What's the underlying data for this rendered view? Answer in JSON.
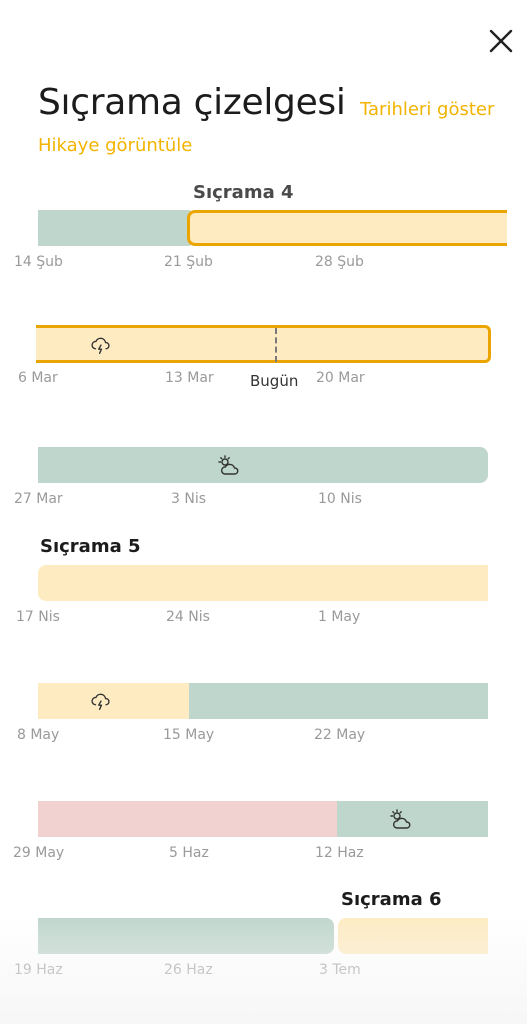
{
  "header": {
    "title": "Sıçrama çizelgesi",
    "show_dates": "Tarihleri göster",
    "view_story": "Hikaye görüntüle",
    "close_icon": "close-icon"
  },
  "leaps": [
    "Sıçrama 4",
    "Sıçrama 5",
    "Sıçrama 6"
  ],
  "weeks": [
    {
      "dates": [
        "14 Şub",
        "21 Şub",
        "28 Şub"
      ]
    },
    {
      "dates": [
        "6 Mar",
        "13 Mar",
        "20 Mar"
      ],
      "today_label": "Bugün",
      "icon": "stormy-cloud-icon"
    },
    {
      "dates": [
        "27 Mar",
        "3 Nis",
        "10 Nis"
      ],
      "icon": "sun-behind-cloud-icon"
    },
    {
      "dates": [
        "17 Nis",
        "24 Nis",
        "1 May"
      ]
    },
    {
      "dates": [
        "8 May",
        "15 May",
        "22 May"
      ],
      "icon": "stormy-cloud-icon"
    },
    {
      "dates": [
        "29 May",
        "5 Haz",
        "12 Haz"
      ],
      "icon": "sun-behind-cloud-icon"
    },
    {
      "dates": [
        "19 Haz",
        "26 Haz",
        "3 Tem"
      ]
    }
  ],
  "colors": {
    "accent": "#f2b400",
    "highlight_border": "#eba500",
    "calm_green": "#bfd6cc",
    "leap_yellow": "#feebc2",
    "stormy_pink": "#f2d2d1"
  }
}
